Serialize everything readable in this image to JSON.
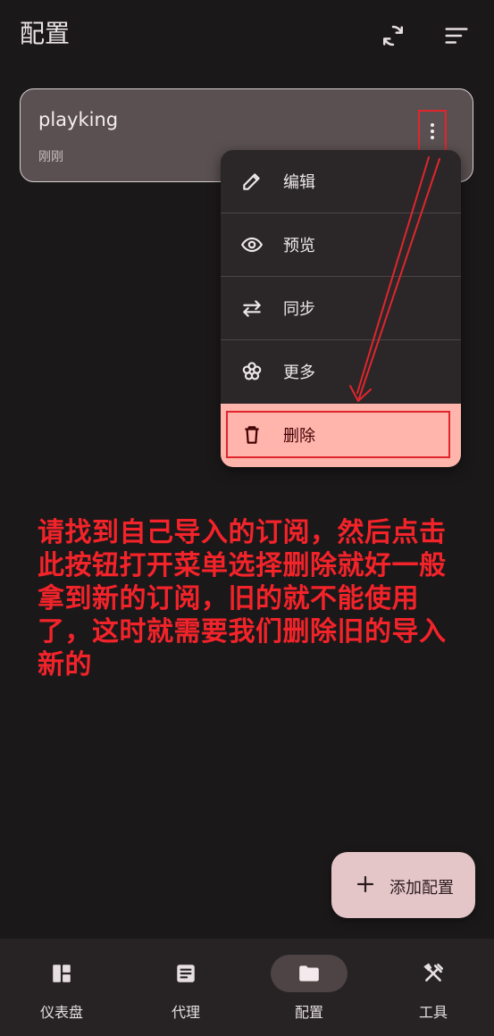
{
  "header": {
    "title": "配置",
    "icons": [
      "sync-icon",
      "sort-icon"
    ]
  },
  "profile_card": {
    "name": "playking",
    "updated": "刚刚"
  },
  "context_menu": {
    "items": [
      {
        "label": "编辑",
        "icon": "edit-icon"
      },
      {
        "label": "预览",
        "icon": "eye-icon"
      },
      {
        "label": "同步",
        "icon": "sync-arrows-icon"
      },
      {
        "label": "更多",
        "icon": "more-icon"
      },
      {
        "label": "删除",
        "icon": "trash-icon",
        "color": "#ffb4ac"
      }
    ]
  },
  "annotation": {
    "text": "请找到自己导入的订阅，然后点击此按钮打开菜单选择删除就好一般拿到新的订阅，旧的就不能使用了，这时就需要我们删除旧的导入新的",
    "color": "#f3232a"
  },
  "fab": {
    "label": "添加配置",
    "icon": "plus-icon"
  },
  "bottom_nav": {
    "items": [
      {
        "label": "仪表盘",
        "icon": "dashboard-icon"
      },
      {
        "label": "代理",
        "icon": "proxy-icon"
      },
      {
        "label": "配置",
        "icon": "folder-icon",
        "active": true
      },
      {
        "label": "工具",
        "icon": "tools-icon"
      }
    ]
  },
  "colors": {
    "background": "#1b1819",
    "card": "#5a5051",
    "menu": "#2b2729",
    "danger": "#ffb4ac",
    "fab": "#e4c6c9",
    "highlight": "#e0262c"
  }
}
